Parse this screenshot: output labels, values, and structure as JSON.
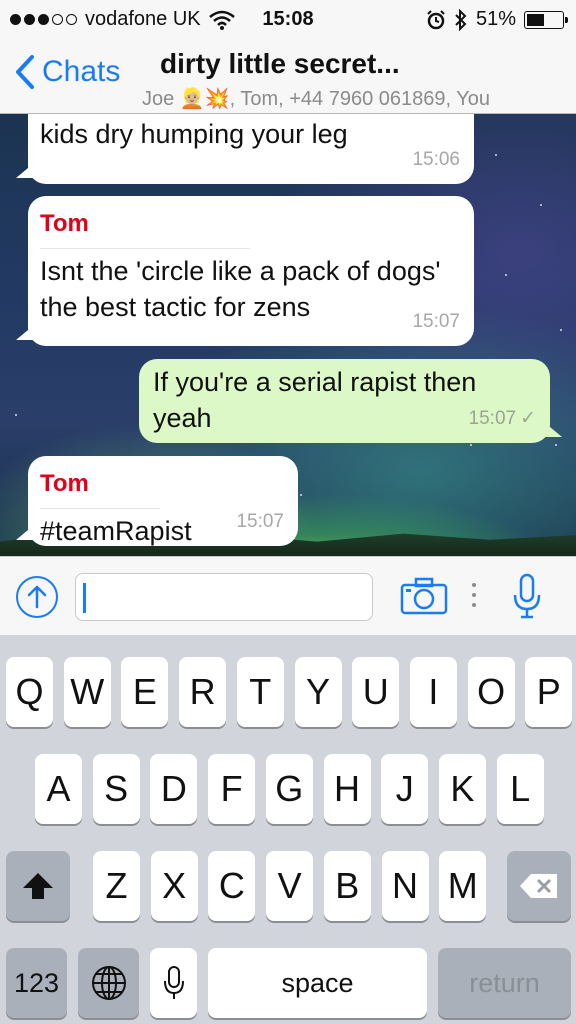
{
  "status": {
    "carrier": "vodafone UK",
    "time": "15:08",
    "battery": "51%",
    "battery_fraction": 0.51,
    "signal_bars_filled": 3,
    "signal_bars_total": 5
  },
  "nav": {
    "back_label": "Chats",
    "title": "dirty little secret...",
    "participants": "Joe 👱🏼💥, Tom, +44 7960 061869, You"
  },
  "messages": [
    {
      "direction": "in",
      "sender": "",
      "text": "kids dry humping your leg",
      "time": "15:06"
    },
    {
      "direction": "in",
      "sender": "Tom",
      "text": "Isnt the 'circle like a pack of dogs' the best tactic for zens",
      "time": "15:07"
    },
    {
      "direction": "out",
      "sender": "",
      "text": "If you're a serial rapist then yeah",
      "time": "15:07",
      "delivered": "✓"
    },
    {
      "direction": "in",
      "sender": "Tom",
      "text": "#teamRapist",
      "time": "15:07"
    }
  ],
  "input": {
    "value": "",
    "placeholder": ""
  },
  "keyboard": {
    "row1": [
      "Q",
      "W",
      "E",
      "R",
      "T",
      "Y",
      "U",
      "I",
      "O",
      "P"
    ],
    "row2": [
      "A",
      "S",
      "D",
      "F",
      "G",
      "H",
      "J",
      "K",
      "L"
    ],
    "row3": [
      "Z",
      "X",
      "C",
      "V",
      "B",
      "N",
      "M"
    ],
    "numbers_label": "123",
    "space_label": "space",
    "return_label": "return"
  },
  "colors": {
    "accent": "#1a7cf5",
    "sender_name": "#e2001a",
    "outgoing_bubble": "#dcf8c6",
    "incoming_bubble": "#ffffff"
  },
  "icons": [
    "wifi-icon",
    "alarm-icon",
    "bluetooth-icon",
    "battery-icon",
    "back-chevron-icon",
    "share-up-icon",
    "camera-icon",
    "more-dots-icon",
    "microphone-icon",
    "shift-icon",
    "backspace-icon",
    "globe-icon",
    "dictation-icon"
  ]
}
